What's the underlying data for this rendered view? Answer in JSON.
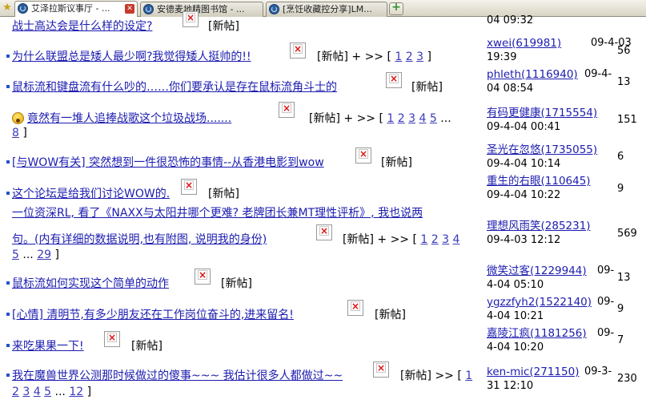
{
  "tabs": [
    {
      "label": "艾泽拉斯议事厅 - ..."
    },
    {
      "label": "安德麦地精图书馆 - ..."
    },
    {
      "label": "[烹饪收藏控分享]LM..."
    }
  ],
  "new_tag": "[新帖]",
  "more_arrow": "+ >>",
  "more_arrow_plain": ">>",
  "bracket_open": "[",
  "bracket_close": "]",
  "ellipsis": "...",
  "threads": [
    {
      "title": "战士高达会是什么样的设定?",
      "author": "",
      "date": "04 09:32",
      "replies": ""
    },
    {
      "title": "为什么联盟总是矮人最少啊?我觉得矮人挺帅的!!",
      "pages": [
        "1",
        "2",
        "3"
      ],
      "author": "xwei(619981)",
      "date_a": "09-4-03",
      "date_b": "19:39",
      "replies": "56"
    },
    {
      "title": "鼠标流和键盘流有什么吵的……你们要承认是存在鼠标流角斗士的",
      "author": "phleth(1116940)",
      "date_a": "09-4-",
      "date_b": "04 08:54",
      "replies": "13"
    },
    {
      "title": "竟然有一堆人追捧战歌这个垃圾战场.......",
      "pages": [
        "1",
        "2",
        "3",
        "4",
        "5"
      ],
      "last_page": "8",
      "author": "有码更健康(1715554)",
      "date": "09-4-04 00:41",
      "replies": "151"
    },
    {
      "title": "[与WOW有关] 突然想到一件很恐怖的事情--从香港电影到wow",
      "author": "圣光在忽悠(1735055)",
      "date": "09-4-04 10:14",
      "replies": "6"
    },
    {
      "title": "这个论坛是给我们讨论WOW的.",
      "author": "重生的右眼(110645)",
      "date": "09-4-04 10:22",
      "replies": "9"
    },
    {
      "title_line1": "一位资深RL, 看了《NAXX与太阳井哪个更难? 老牌团长兼MT理性评析》, 我也说两",
      "title_line2": "句。(内有详细的数据说明,也有附图, 说明我的身份)",
      "pages": [
        "1",
        "2",
        "3",
        "4",
        "5"
      ],
      "last_page": "29",
      "author": "理想风雨笑(285231)",
      "date": "09-4-03 12:12",
      "replies": "569"
    },
    {
      "title": "鼠标流如何实现这个简单的动作",
      "author": "微笑过客(1229944)",
      "date_a": "09-",
      "date_b": "4-04 05:10",
      "replies": "13"
    },
    {
      "title": "[心情] 清明节,有多少朋友还在工作岗位奋斗的,进来留名!",
      "author": "ygzzfyh2(1522140)",
      "date_a": "09-",
      "date_b": "4-04 10:21",
      "replies": "9"
    },
    {
      "title": "来吃果果一下!",
      "author": "嘉陵江疯(1181256)",
      "date_a": "09-",
      "date_b": "4-04 10:20",
      "replies": "7"
    },
    {
      "title": "我在魔兽世界公测那时候做过的傻事~~~ 我估计很多人都做过~~",
      "pages": [
        "1",
        "2",
        "3",
        "4",
        "5"
      ],
      "last_page": "12",
      "author": "ken-mic(271150)",
      "date_a": "09-3-",
      "date_b": "31 12:10",
      "replies": "230"
    }
  ],
  "colors": {
    "link": "#1c1cb0",
    "bullet": "#2453c8",
    "broken_image_x": "#dd1111"
  },
  "icons": [
    "favorites-star-icon",
    "globe-favicon",
    "tab-close-icon",
    "new-tab-icon",
    "broken-image-icon",
    "surprised-emoji-icon",
    "list-bullet-icon"
  ]
}
